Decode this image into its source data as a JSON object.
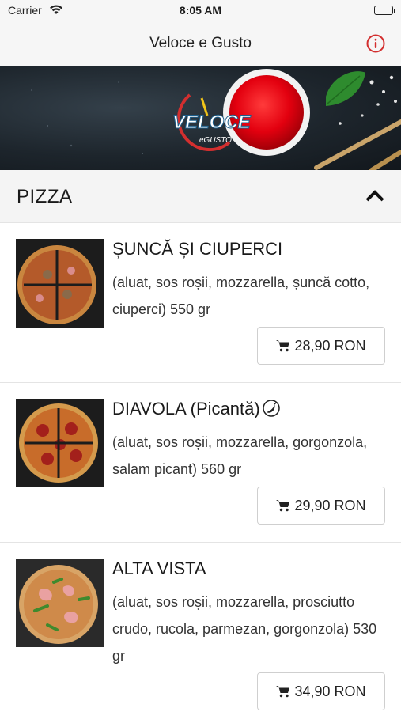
{
  "status_bar": {
    "carrier": "Carrier",
    "time": "8:05 AM"
  },
  "nav": {
    "title": "Veloce e Gusto",
    "info_icon": "info-icon"
  },
  "banner": {
    "logo_text": "VELOCE",
    "logo_subtext": "eGUSTO"
  },
  "section": {
    "label": "PIZZA",
    "chevron_icon": "chevron-up-icon"
  },
  "products": [
    {
      "name": "ȘUNCĂ ȘI CIUPERCI",
      "description": "(aluat, sos roșii, mozzarella, șuncă cotto, ciuperci) 550 gr",
      "price": "28,90 RON"
    },
    {
      "name": "DIAVOLA (Picantă)",
      "description": "(aluat, sos roșii, mozzarella, gorgonzola, salam picant) 560 gr",
      "price": "29,90 RON",
      "spicy_icon": "chili-icon"
    },
    {
      "name": "ALTA VISTA",
      "description": "(aluat, sos roșii, mozzarella, prosciutto crudo, rucola, parmezan, gorgonzola) 530 gr",
      "price": "34,90 RON"
    }
  ],
  "colors": {
    "accent": "#d32f2f",
    "header_bg": "#f6f6f6"
  }
}
